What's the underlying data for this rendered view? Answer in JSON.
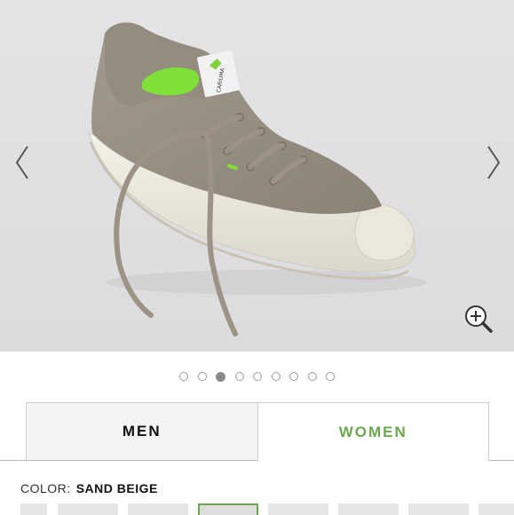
{
  "gallery": {
    "image_alt": "Sand beige knit sneaker",
    "brand_tag": "CARIUMA",
    "prev_icon": "chevron-left-icon",
    "next_icon": "chevron-right-icon",
    "zoom_icon": "zoom-in-icon",
    "slide_count": 9,
    "active_slide": 3
  },
  "gender_tabs": {
    "men_label": "MEN",
    "women_label": "WOMEN",
    "selected": "WOMEN",
    "accent_color": "#6aa84f"
  },
  "color": {
    "label": "COLOR:",
    "value": "SAND BEIGE"
  },
  "swatches": {
    "count": 8,
    "selected_index": 3
  }
}
